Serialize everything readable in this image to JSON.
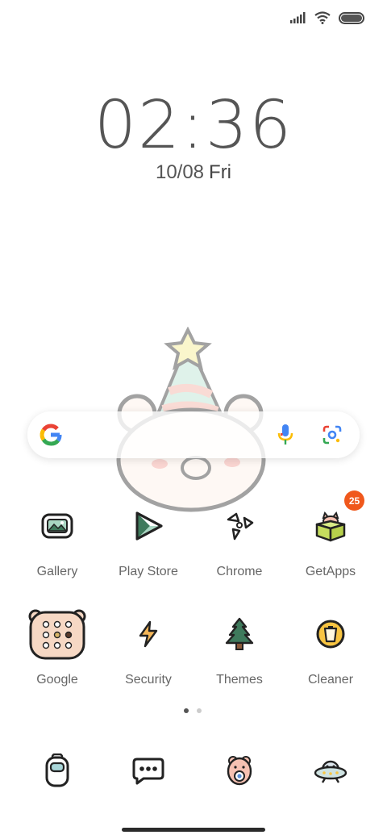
{
  "status_bar": {
    "signal_icon": "signal-bars-icon",
    "wifi_icon": "wifi-icon",
    "battery_icon": "battery-icon",
    "battery_level": 1.0
  },
  "lock_clock": {
    "time": "02:36",
    "date": "10/08",
    "weekday": "Fri"
  },
  "search_bar": {
    "logo": "google-g-icon",
    "mic": "mic-icon",
    "lens": "google-lens-icon"
  },
  "apps_row1": [
    {
      "label": "Gallery",
      "icon": "gallery-icon"
    },
    {
      "label": "Play Store",
      "icon": "play-store-icon"
    },
    {
      "label": "Chrome",
      "icon": "chrome-icon"
    },
    {
      "label": "GetApps",
      "icon": "getapps-icon",
      "badge": "25"
    }
  ],
  "apps_row2": [
    {
      "label": "Google",
      "icon": "google-folder-icon"
    },
    {
      "label": "Security",
      "icon": "security-icon"
    },
    {
      "label": "Themes",
      "icon": "themes-icon"
    },
    {
      "label": "Cleaner",
      "icon": "cleaner-icon"
    }
  ],
  "dock": [
    {
      "icon": "phone-icon"
    },
    {
      "icon": "messages-icon"
    },
    {
      "icon": "camera-icon"
    },
    {
      "icon": "browser-icon"
    }
  ],
  "page_indicator": {
    "count": 2,
    "active": 1
  },
  "colors": {
    "badge": "#f0581c",
    "text": "#555555",
    "background": "#ffffff"
  }
}
